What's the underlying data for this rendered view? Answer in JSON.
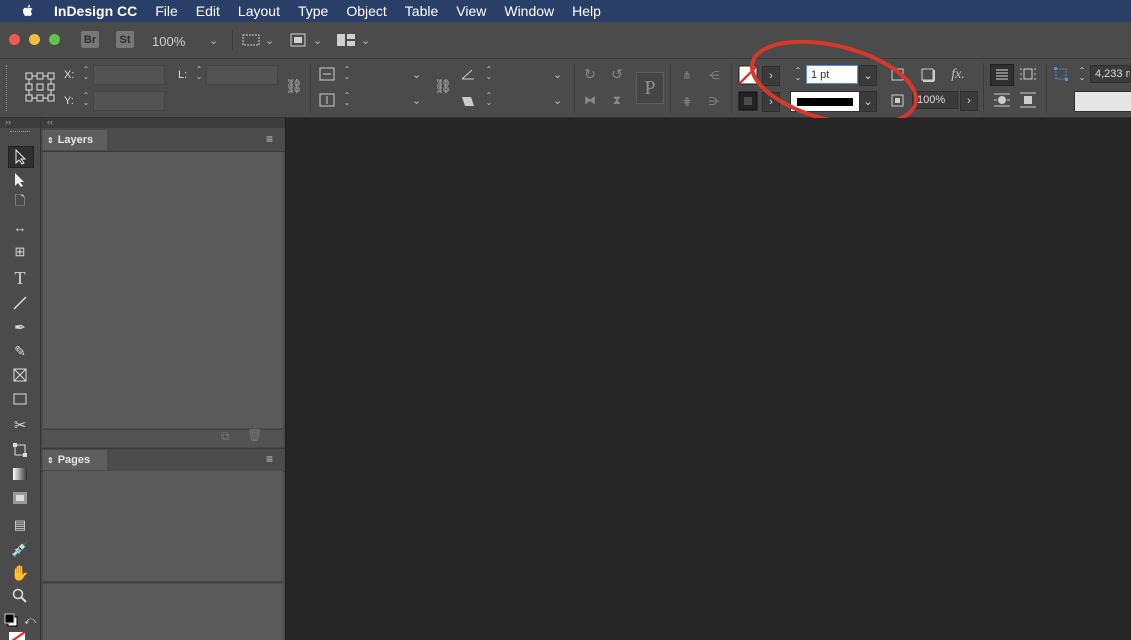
{
  "menubar": {
    "app_name": "InDesign CC",
    "items": [
      "File",
      "Edit",
      "Layout",
      "Type",
      "Object",
      "Table",
      "View",
      "Window",
      "Help"
    ]
  },
  "appbar": {
    "bridge_label": "Br",
    "stock_label": "St",
    "zoom_value": "100%"
  },
  "control": {
    "x_label": "X:",
    "y_label": "Y:",
    "l_label": "L:",
    "stroke_weight": "1 pt",
    "opacity": "100%",
    "paragraph_icon": "P",
    "fx_label": "fx.",
    "column_value": "4,233 m"
  },
  "panels": {
    "layers_title": "Layers",
    "pages_title": "Pages"
  },
  "colors": {
    "menubar": "#2a3f67",
    "annotation": "#d8372a",
    "canvas": "#262626"
  },
  "tools": [
    "selection-tool",
    "direct-selection-tool",
    "page-tool",
    "gap-tool",
    "content-collector-tool",
    "type-tool",
    "line-tool",
    "pen-tool",
    "pencil-tool",
    "rectangle-frame-tool",
    "rectangle-tool",
    "scissors-tool",
    "free-transform-tool",
    "gradient-swatch-tool",
    "gradient-feather-tool",
    "note-tool",
    "eyedropper-tool",
    "hand-tool",
    "zoom-tool"
  ]
}
